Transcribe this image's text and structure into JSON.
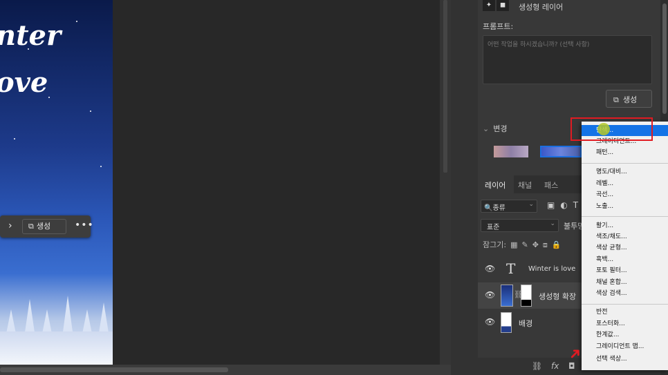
{
  "canvas": {
    "line1": "nter",
    "line2": "ove"
  },
  "taskbar": {
    "next_icon": "chevron-right-icon",
    "generate_label": "생성",
    "more_label": "•••"
  },
  "properties": {
    "title": "생성형 레이어",
    "prompt_label": "프롬프트:",
    "prompt_placeholder": "어떤 작업을 하시겠습니까? (선택 사항)",
    "generate_label": "생성",
    "variants_label": "변경"
  },
  "layers": {
    "tabs": [
      "레이어",
      "채널",
      "패스"
    ],
    "filter_label": "종류",
    "blend_mode": "표준",
    "opacity_label": "불투명",
    "lock_label": "잠그기:",
    "items": [
      {
        "name": "Winter is love",
        "type": "text"
      },
      {
        "name": "생성형 확장",
        "type": "generative"
      },
      {
        "name": "배경",
        "type": "background"
      }
    ]
  },
  "adjust_menu": {
    "items": [
      "단색...",
      "그레이디언트...",
      "패턴...",
      "명도/대비...",
      "레벨...",
      "곡선...",
      "노출...",
      "활기...",
      "색조/채도...",
      "색상 균형...",
      "흑백...",
      "포토 필터...",
      "채널 혼합...",
      "색상 검색...",
      "반전",
      "포스터화...",
      "한계값...",
      "그레이디언트 맵...",
      "선택 색상..."
    ],
    "highlighted_index": 0
  },
  "colors": {
    "accent": "#1473e6",
    "callout": "#e11b22"
  }
}
